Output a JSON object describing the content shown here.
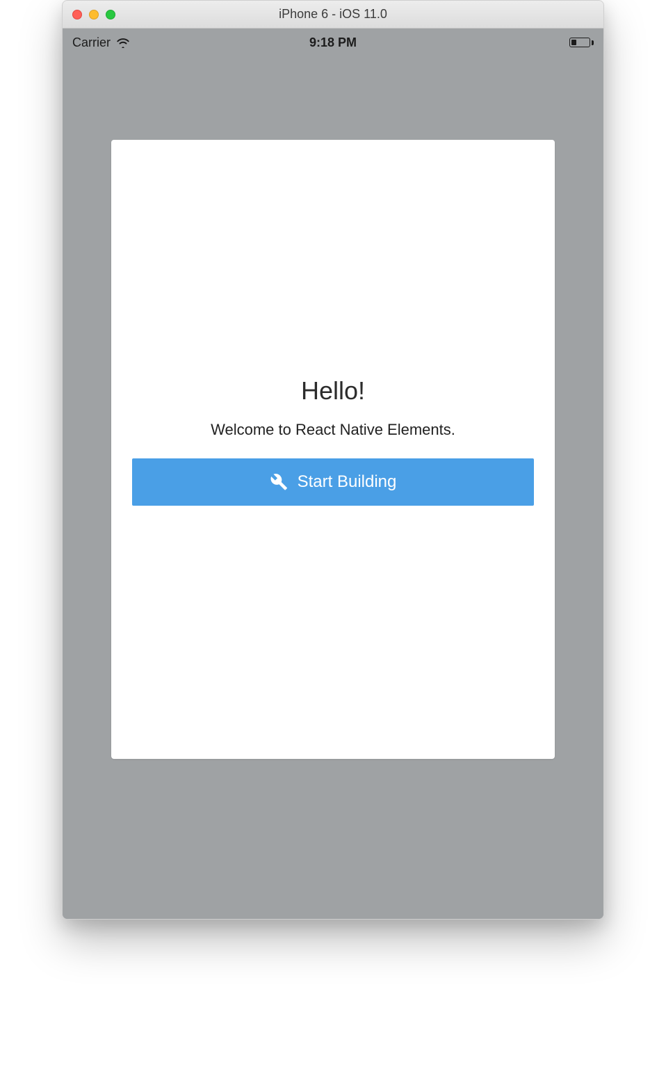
{
  "window": {
    "title": "iPhone 6 - iOS 11.0"
  },
  "statusbar": {
    "carrier": "Carrier",
    "time": "9:18 PM"
  },
  "card": {
    "title": "Hello!",
    "subtitle": "Welcome to React Native Elements.",
    "button_label": "Start Building"
  },
  "colors": {
    "accent": "#4a9fe6",
    "screen_bg": "#9fa2a4"
  }
}
